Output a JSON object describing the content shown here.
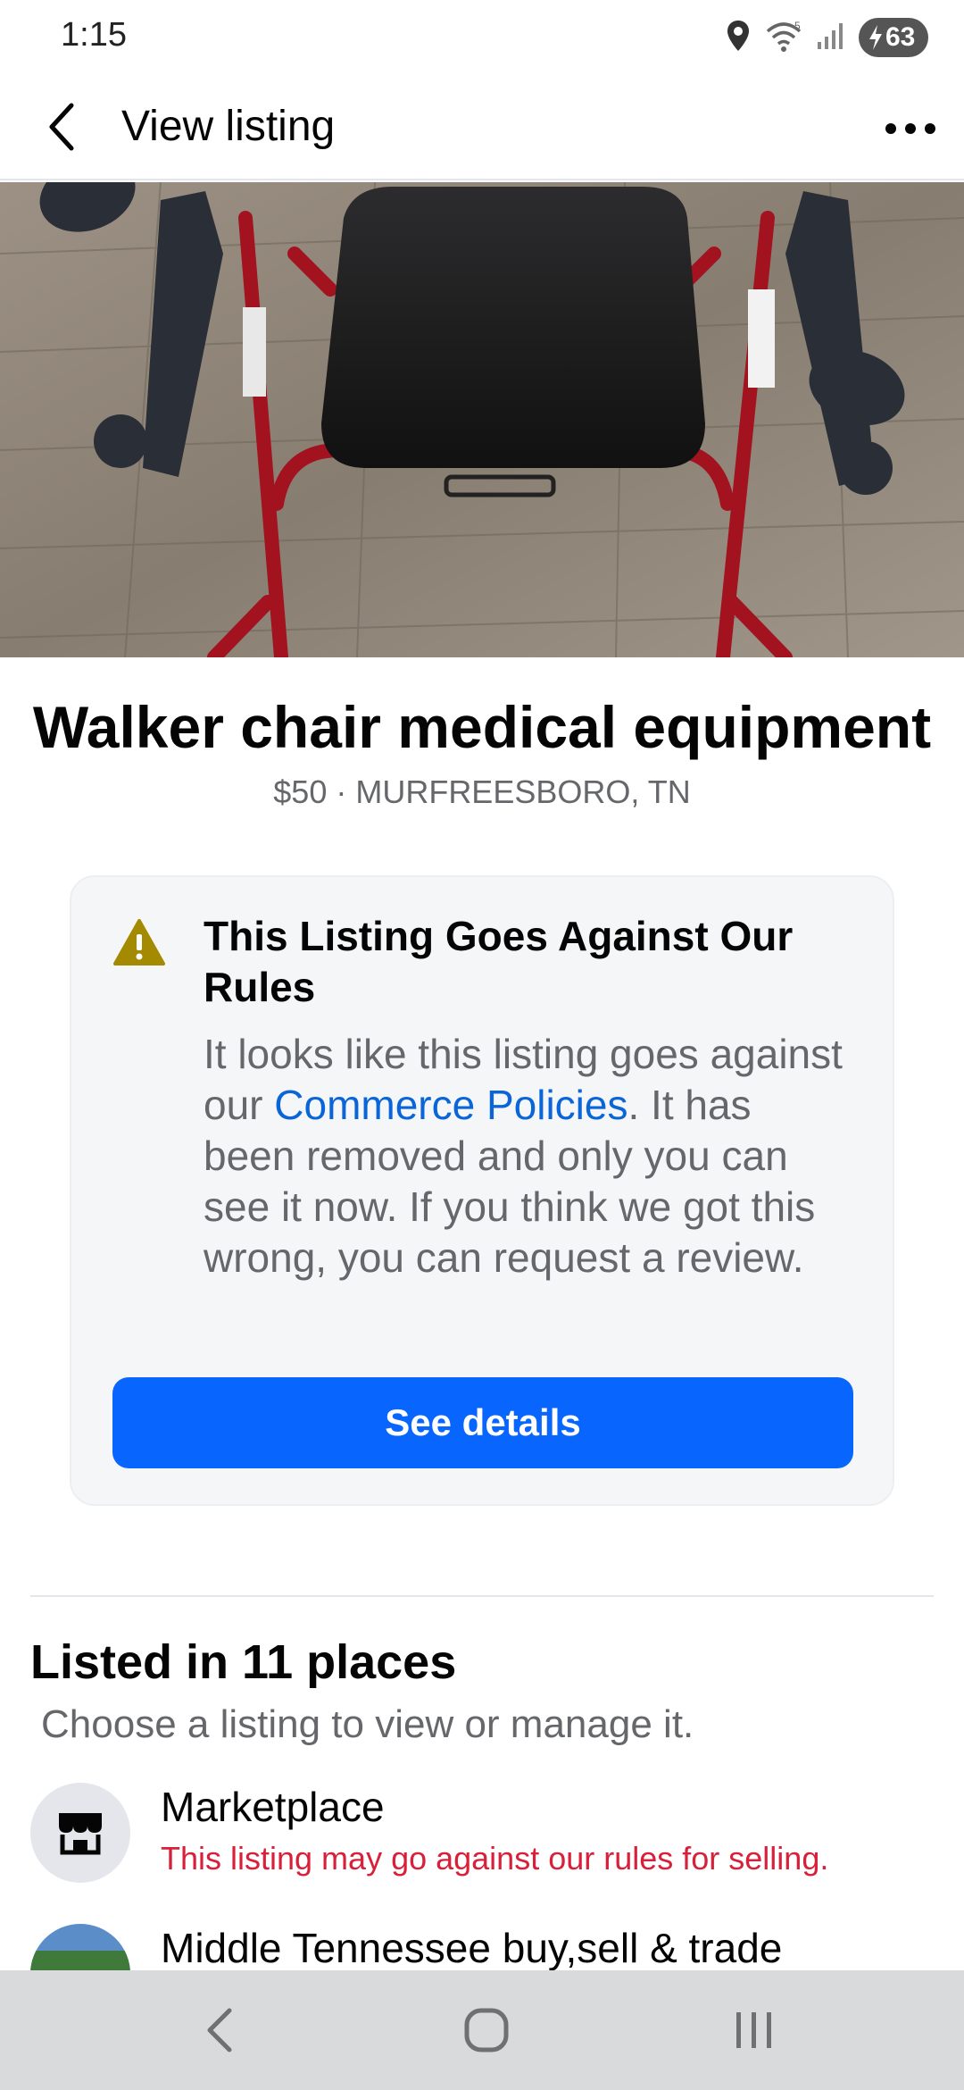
{
  "status_bar": {
    "time": "1:15",
    "battery": "63",
    "icons": [
      "location-icon",
      "wifi-icon",
      "signal-icon",
      "battery-charging-icon"
    ]
  },
  "header": {
    "title": "View listing",
    "back_icon": "chevron-left-icon",
    "more_icon": "more-horizontal-icon"
  },
  "listing": {
    "title": "Walker chair medical equipment",
    "subtitle": "$50 · MURFREESBORO, TN"
  },
  "warning": {
    "icon": "warning-triangle-icon",
    "title": "This Listing Goes Against Our Rules",
    "body_before": "It looks like this listing goes against our ",
    "link_text": "Commerce Policies",
    "body_after": ". It has been removed and only you can see it now. If you think we got this wrong, you can request a review.",
    "button_label": "See details",
    "icon_color": "#a08000",
    "link_color": "#0a66d8",
    "button_color": "#0866ff"
  },
  "places": {
    "title": "Listed in 11 places",
    "subtitle": "Choose a listing to view or manage it.",
    "items": [
      {
        "name": "Marketplace",
        "note": "This listing may go against our rules for selling.",
        "icon": "storefront-icon"
      },
      {
        "name": "Middle Tennessee buy,sell & trade",
        "note": "",
        "icon": "group-photo-avatar"
      }
    ],
    "note_color": "#d8203a"
  },
  "nav_bar": {
    "icons": [
      "nav-back-icon",
      "nav-home-icon",
      "nav-recents-icon"
    ]
  }
}
